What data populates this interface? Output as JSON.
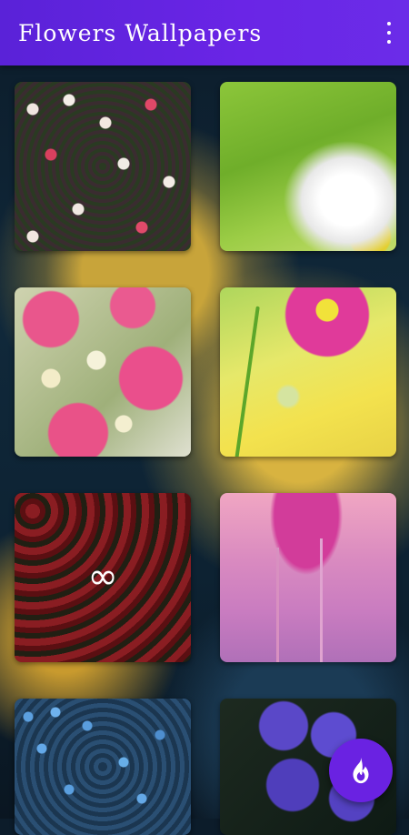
{
  "app": {
    "title": "Flowers Wallpapers",
    "accent_color": "#6a25e6"
  },
  "toolbar": {
    "more_icon": "more-vert-icon"
  },
  "wallpapers": [
    {
      "subject": "daisies and pink flowers field",
      "colors": [
        "#f0e8e2",
        "#e04868",
        "#2a3a22"
      ]
    },
    {
      "subject": "white daisy close-up",
      "colors": [
        "#ffffff",
        "#e4cf30",
        "#8cc63a"
      ]
    },
    {
      "subject": "pink roses with daisies",
      "colors": [
        "#e9568c",
        "#f5f2da",
        "#9fb07a"
      ]
    },
    {
      "subject": "magenta cosmos flower",
      "colors": [
        "#e03a9a",
        "#f1e23a",
        "#e6e86a"
      ]
    },
    {
      "subject": "red roses",
      "colors": [
        "#b9272e",
        "#701418"
      ],
      "overlay_icon": "infinity-icon",
      "overlay_text": "∞"
    },
    {
      "subject": "purple anemone flower",
      "colors": [
        "#d23c9a",
        "#f0a6c2",
        "#b070b8"
      ]
    },
    {
      "subject": "blue forget-me-nots",
      "colors": [
        "#5ca0e0",
        "#1b3650"
      ]
    },
    {
      "subject": "purple lisianthus flowers",
      "colors": [
        "#5a48c8",
        "#1d2a20"
      ]
    }
  ],
  "fab": {
    "icon": "flame-icon",
    "color": "#6a22e2"
  }
}
